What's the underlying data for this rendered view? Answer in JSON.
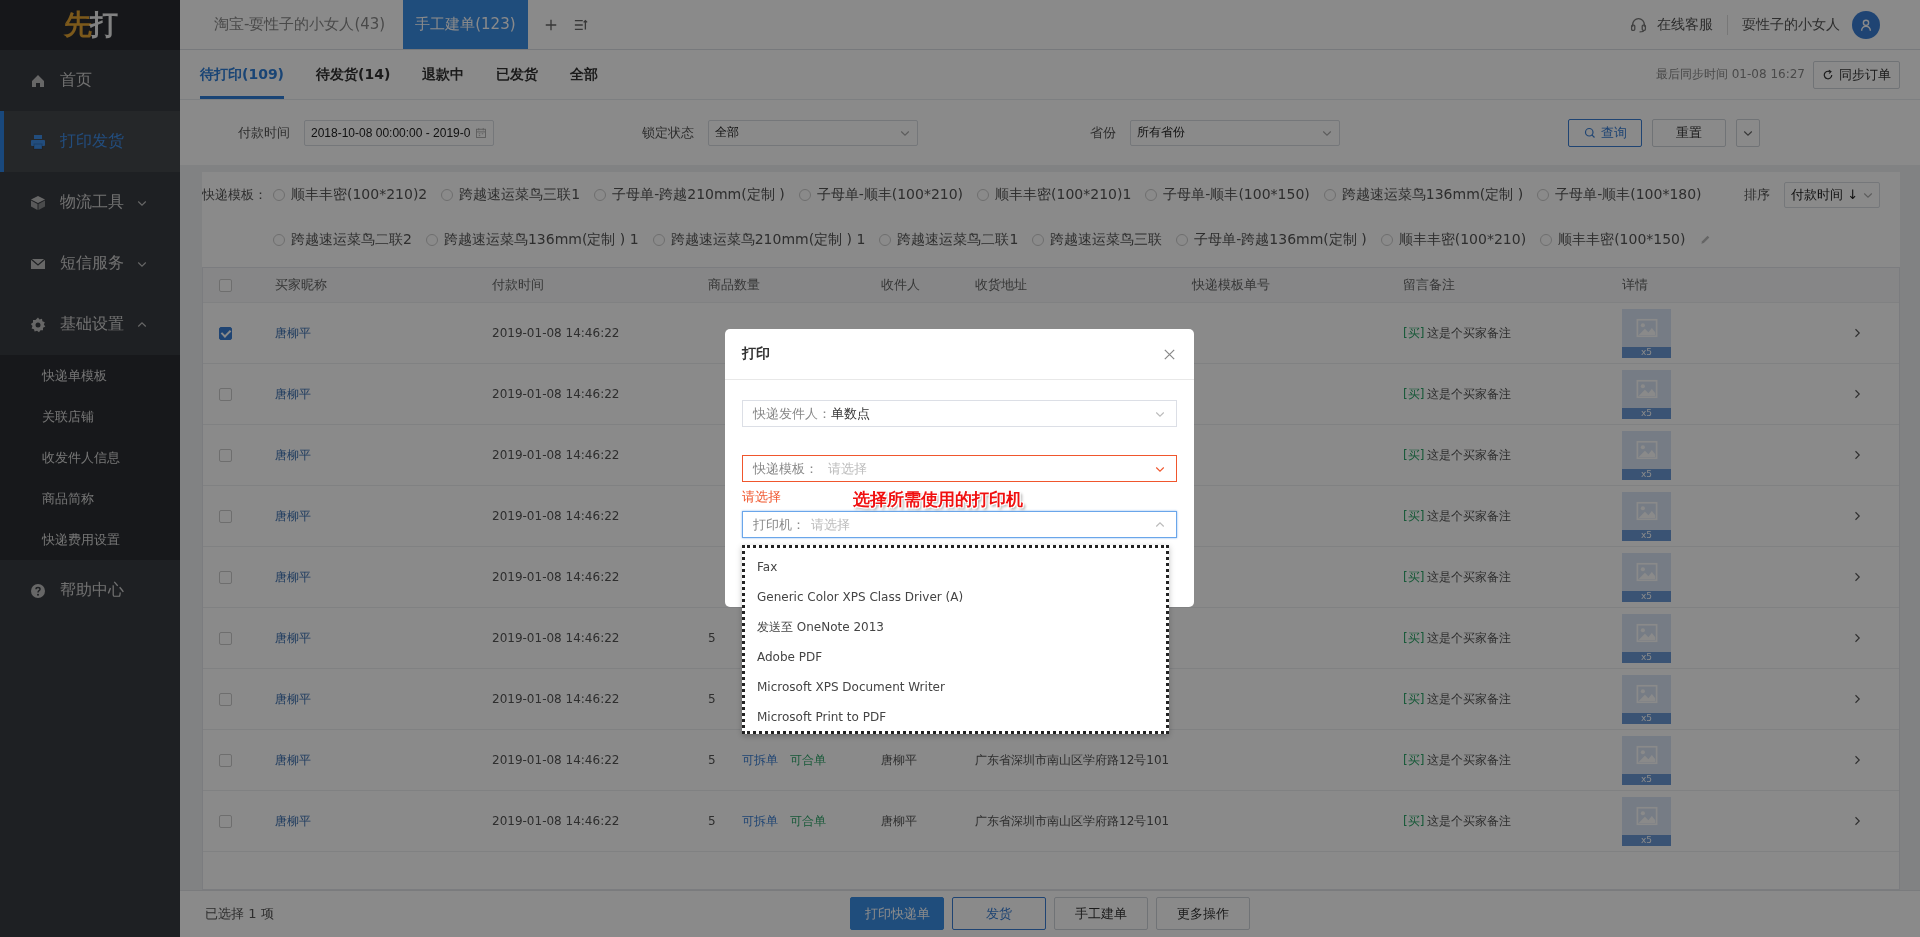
{
  "logo": {
    "text": "先打"
  },
  "sidebar": {
    "items": [
      {
        "label": "首页",
        "selected": false
      },
      {
        "label": "打印发货",
        "selected": true
      },
      {
        "label": "物流工具",
        "selected": false,
        "expanded": false
      },
      {
        "label": "短信服务",
        "selected": false,
        "expanded": false
      },
      {
        "label": "基础设置",
        "selected": false,
        "expanded": true,
        "children": [
          {
            "label": "快递单模板",
            "selected": false
          },
          {
            "label": "关联店铺",
            "selected": false
          },
          {
            "label": "收发件人信息",
            "selected": false
          },
          {
            "label": "商品简称",
            "selected": false
          },
          {
            "label": "快递费用设置",
            "selected": false
          }
        ]
      },
      {
        "label": "帮助中心",
        "selected": false
      }
    ]
  },
  "shop_tabs": [
    {
      "label": "淘宝-耍性子的小女人(43)",
      "selected": false
    },
    {
      "label": "手工建单(123)",
      "selected": true
    }
  ],
  "header": {
    "service": "在线客服",
    "user": "耍性子的小女人"
  },
  "status_tabs": [
    {
      "label": "待打印(109)",
      "selected": true
    },
    {
      "label": "待发货(14)",
      "selected": false
    },
    {
      "label": "退款中",
      "selected": false
    },
    {
      "label": "已发货",
      "selected": false
    },
    {
      "label": "全部",
      "selected": false
    }
  ],
  "sync": {
    "text": "最后同步时间 01-08 16:27",
    "button": "同步订单"
  },
  "filters": [
    {
      "kind": "date",
      "label": "付款时间",
      "value": "2018-10-08 00:00:00 - 2019-0"
    },
    {
      "kind": "select",
      "label": "锁定状态",
      "value": "全部"
    },
    {
      "kind": "select",
      "label": "省份",
      "value": "所有省份"
    }
  ],
  "filter_buttons": [
    {
      "kind": "search",
      "label": "查询"
    },
    {
      "kind": "plain",
      "label": "重置"
    },
    {
      "kind": "toggle"
    }
  ],
  "templates": {
    "label": "快递模板：",
    "options": [
      {
        "label": "顺丰丰密(100*210)2",
        "selected": false
      },
      {
        "label": "跨越速运菜鸟三联1",
        "selected": false
      },
      {
        "label": "子母单-跨越210mm(定制 )",
        "selected": false
      },
      {
        "label": "子母单-顺丰(100*210)",
        "selected": false
      },
      {
        "label": "顺丰丰密(100*210)1",
        "selected": false
      },
      {
        "label": "子母单-顺丰(100*150)",
        "selected": false
      },
      {
        "label": "跨越速运菜鸟136mm(定制 )",
        "selected": false
      },
      {
        "label": "子母单-顺丰(100*180)",
        "selected": false
      },
      {
        "label": "跨越速运菜鸟二联2",
        "selected": false
      },
      {
        "label": "跨越速运菜鸟136mm(定制 ) 1",
        "selected": false
      },
      {
        "label": "跨越速运菜鸟210mm(定制 ) 1",
        "selected": false
      },
      {
        "label": "跨越速运菜鸟二联1",
        "selected": false
      },
      {
        "label": "跨越速运菜鸟三联",
        "selected": false
      },
      {
        "label": "子母单-跨越136mm(定制 )",
        "selected": false
      },
      {
        "label": "顺丰丰密(100*210)",
        "selected": false
      },
      {
        "label": "顺丰丰密(100*150)",
        "selected": false
      }
    ]
  },
  "sort": {
    "label": "排序",
    "value": "付款时间 ↓"
  },
  "table": {
    "header_checked": false,
    "columns": [
      "买家昵称",
      "付款时间",
      "商品数量",
      "收件人",
      "收货地址",
      "快递模板单号",
      "留言备注",
      "详情"
    ],
    "rows": [
      {
        "checked": true,
        "nickname": "唐柳平",
        "paid_at": "2019-01-08 14:46:22",
        "tag": "[买]",
        "note": "这是个买家备注",
        "thumb_count": "x5"
      },
      {
        "checked": false,
        "nickname": "唐柳平",
        "paid_at": "2019-01-08 14:46:22",
        "tag": "[买]",
        "note": "这是个买家备注",
        "thumb_count": "x5"
      },
      {
        "checked": false,
        "nickname": "唐柳平",
        "paid_at": "2019-01-08 14:46:22",
        "tag": "[买]",
        "note": "这是个买家备注",
        "thumb_count": "x5"
      },
      {
        "checked": false,
        "nickname": "唐柳平",
        "paid_at": "2019-01-08 14:46:22",
        "tag": "[买]",
        "note": "这是个买家备注",
        "thumb_count": "x5"
      },
      {
        "checked": false,
        "nickname": "唐柳平",
        "paid_at": "2019-01-08 14:46:22",
        "tag": "[买]",
        "note": "这是个买家备注",
        "thumb_count": "x5"
      },
      {
        "checked": false,
        "nickname": "唐柳平",
        "paid_at": "2019-01-08 14:46:22",
        "quantity": "5",
        "tag": "[买]",
        "note": "这是个买家备注",
        "thumb_count": "x5"
      },
      {
        "checked": false,
        "nickname": "唐柳平",
        "paid_at": "2019-01-08 14:46:22",
        "quantity": "5",
        "tag": "[买]",
        "note": "这是个买家备注",
        "thumb_count": "x5"
      },
      {
        "checked": false,
        "nickname": "唐柳平",
        "paid_at": "2019-01-08 14:46:22",
        "quantity": "5",
        "split": "可拆单",
        "merge": "可合单",
        "receiver": "唐柳平",
        "address": "广东省深圳市南山区学府路12号101",
        "tag": "[买]",
        "note": "这是个买家备注",
        "thumb_count": "x5"
      },
      {
        "checked": false,
        "nickname": "唐柳平",
        "paid_at": "2019-01-08 14:46:22",
        "quantity": "5",
        "split": "可拆单",
        "merge": "可合单",
        "receiver": "唐柳平",
        "address": "广东省深圳市南山区学府路12号101",
        "tag": "[买]",
        "note": "这是个买家备注",
        "thumb_count": "x5"
      }
    ]
  },
  "footer": {
    "selected_text": "已选择 1 项",
    "buttons": [
      {
        "kind": "primary",
        "label": "打印快递单"
      },
      {
        "kind": "outline",
        "label": "发货"
      },
      {
        "kind": "plain",
        "label": "手工建单"
      },
      {
        "kind": "plain",
        "label": "更多操作"
      }
    ]
  },
  "dialog": {
    "title": "打印",
    "fields": [
      {
        "label": "快递发件人：",
        "value": "单数点",
        "invalid": false,
        "open": false
      },
      {
        "label": "快递模板：",
        "placeholder": "请选择",
        "invalid": true,
        "open": false,
        "error": "请选择"
      },
      {
        "label": "打印机：",
        "placeholder": "请选择",
        "invalid": false,
        "open": true
      }
    ],
    "options": [
      "Fax",
      "Generic Color XPS Class Driver (A)",
      "发送至 OneNote 2013",
      "Adobe PDF",
      "Microsoft XPS Document Writer",
      "Microsoft Print to PDF"
    ],
    "annotation": "选择所需使用的打印机"
  }
}
